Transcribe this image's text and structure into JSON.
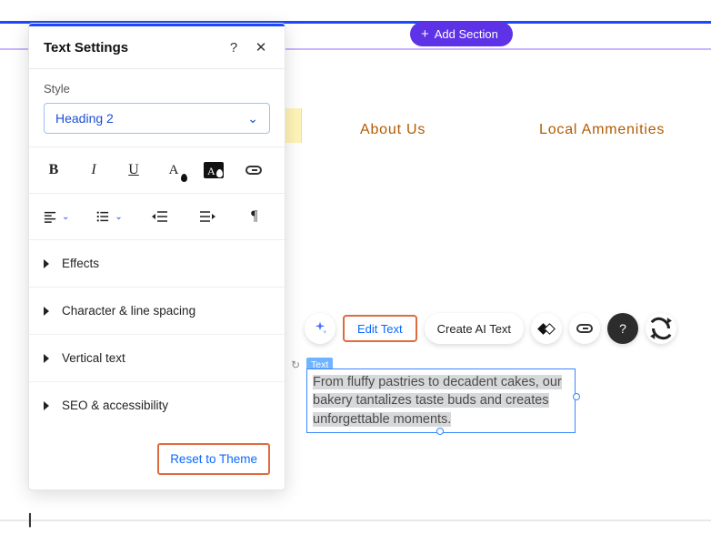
{
  "topbar": {
    "add_section_label": "Add Section"
  },
  "nav": {
    "about": "About Us",
    "local": "Local Ammenities"
  },
  "panel": {
    "title": "Text Settings",
    "style_label": "Style",
    "style_value": "Heading 2",
    "accordion": {
      "effects": "Effects",
      "spacing": "Character & line spacing",
      "vertical": "Vertical text",
      "seo": "SEO & accessibility"
    },
    "reset": "Reset to Theme"
  },
  "ctx": {
    "edit_text": "Edit Text",
    "create_ai": "Create AI Text"
  },
  "text_element": {
    "badge": "Text",
    "content": "From fluffy pastries to decadent cakes, our bakery tantalizes taste buds and creates unforgettable moments."
  },
  "icons": {
    "help": "?",
    "close": "✕",
    "bold": "B",
    "italic": "I",
    "underline": "U",
    "fontA": "A",
    "link": "link",
    "align": "align-left",
    "list": "list-bullets",
    "indent_dec": "indent-decrease",
    "indent_inc": "indent-increase",
    "pilcrow": "pilcrow",
    "sparkle": "sparkle",
    "anim": "animation",
    "chain": "link",
    "qmark": "?",
    "swap": "swap"
  }
}
